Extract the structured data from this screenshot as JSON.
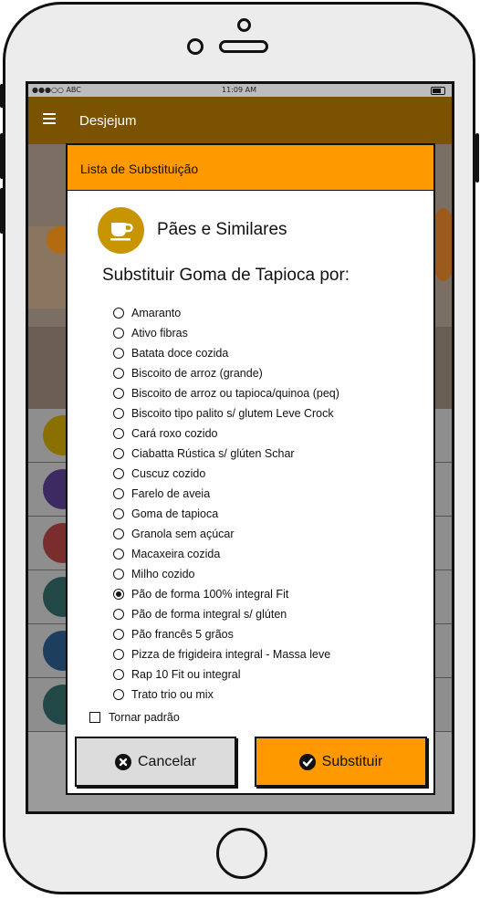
{
  "status_bar": {
    "carrier": "●●●○○ ABC",
    "time": "11:09 AM"
  },
  "app_bar": {
    "title": "Desjejum"
  },
  "modal": {
    "title": "Lista de Substituição",
    "category": "Pães e Similares",
    "question": "Substituir Goma de Tapioca por:",
    "options": [
      "Amaranto",
      "Ativo fibras",
      "Batata doce cozida",
      "Biscoito de arroz (grande)",
      "Biscoito de arroz ou tapioca/quinoa (peq)",
      "Biscoito tipo palito s/ glutem Leve Crock",
      "Cará roxo cozido",
      "Ciabatta Rústica s/ glúten Schar",
      "Cuscuz cozido",
      "Farelo de aveia",
      "Goma de tapioca",
      "Granola sem açúcar",
      "Macaxeira cozida",
      "Milho cozido",
      "Pão de forma 100% integral Fit",
      "Pão de forma integral s/ glúten",
      "Pão francês 5 grãos",
      "Pizza de frigideira integral - Massa leve",
      "Rap 10 Fit ou integral",
      "Trato trio ou mix"
    ],
    "selected_index": 14,
    "default_label": "Tornar padrão",
    "cancel_label": "Cancelar",
    "submit_label": "Substituir"
  },
  "colors": {
    "accent": "#ff9900",
    "app_bar": "#7a5200",
    "category_icon": "#c89400"
  }
}
